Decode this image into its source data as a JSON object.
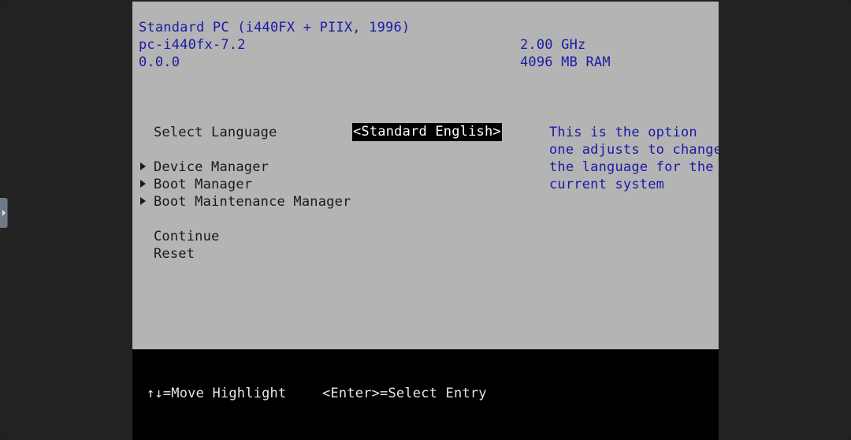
{
  "header": {
    "machine": "Standard PC (i440FX + PIIX, 1996)",
    "version": "pc-i440fx-7.2",
    "revision": "0.0.0",
    "cpu_speed": "2.00 GHz",
    "memory": "4096 MB RAM"
  },
  "menu": {
    "language_label": "Select Language",
    "language_value": "<Standard English>",
    "items": [
      {
        "label": "Device Manager"
      },
      {
        "label": "Boot Manager"
      },
      {
        "label": "Boot Maintenance Manager"
      }
    ],
    "actions": [
      {
        "label": "Continue"
      },
      {
        "label": "Reset"
      }
    ]
  },
  "help": {
    "lines": [
      "This is the option",
      "one adjusts to change",
      "the language for the",
      "current system"
    ]
  },
  "footer": {
    "move_hint": "↑↓=Move Highlight",
    "select_hint": "<Enter>=Select Entry"
  },
  "colors": {
    "panel": "#b4b4b4",
    "blue_text": "#1a1aa6",
    "dark_text": "#1a1a1a",
    "footer_bg": "#000000"
  }
}
